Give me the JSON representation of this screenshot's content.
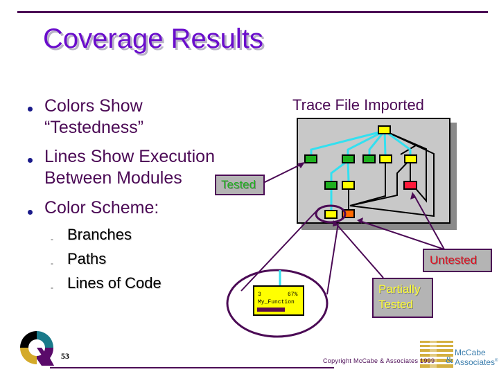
{
  "slide": {
    "title": "Coverage Results",
    "page_number": "53",
    "copyright": "Copyright McCabe & Associates 1999",
    "company": {
      "line1": "McCabe",
      "line2": "Associates",
      "mark": "®"
    }
  },
  "bullets": [
    {
      "line1": "Colors Show",
      "line2": "“Testedness”"
    },
    {
      "line1": "Lines Show Execution",
      "line2": "Between Modules"
    },
    {
      "line1": "Color Scheme:",
      "line2": ""
    }
  ],
  "sub_bullets": [
    "Branches",
    "Paths",
    "Lines of Code"
  ],
  "diagram": {
    "heading": "Trace File Imported",
    "legend_colors": {
      "tested": "#1fb01f",
      "partial": "#ffff00",
      "untested": "#ff1a3a",
      "other": "#ff6a00"
    }
  },
  "callouts": {
    "tested": "Tested",
    "untested": "Untested",
    "partial_line1": "Partially",
    "partial_line2": "Tested"
  },
  "zoom_module": {
    "count": "3",
    "percent": "67%",
    "name": "My_Function",
    "coverage_fraction": 0.67
  }
}
